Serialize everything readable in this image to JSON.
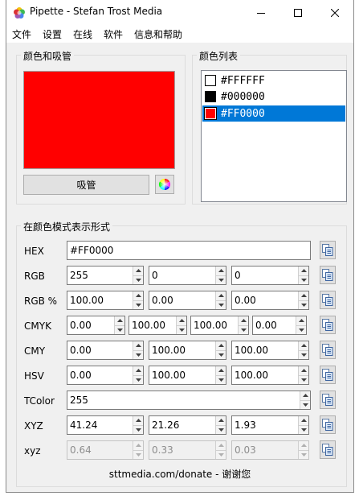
{
  "window": {
    "title": "Pipette - Stefan Trost Media"
  },
  "menu": [
    "文件",
    "设置",
    "在线",
    "软件",
    "信息和帮助"
  ],
  "color_group": {
    "title": "颜色和吸管",
    "pipette_button": "吸管",
    "preview_color": "#FF0000"
  },
  "list_group": {
    "title": "颜色列表",
    "items": [
      {
        "label": "#FFFFFF",
        "color": "#FFFFFF",
        "selected": false
      },
      {
        "label": "#000000",
        "color": "#000000",
        "selected": false
      },
      {
        "label": "#FF0000",
        "color": "#FF0000",
        "selected": true
      }
    ]
  },
  "modes_group": {
    "title": "在颜色模式表示形式",
    "rows": [
      {
        "label": "HEX",
        "fields": [
          "#FF0000"
        ]
      },
      {
        "label": "RGB",
        "fields": [
          "255",
          "0",
          "0"
        ]
      },
      {
        "label": "RGB %",
        "fields": [
          "100.00",
          "0.00",
          "0.00"
        ]
      },
      {
        "label": "CMYK",
        "fields": [
          "0.00",
          "100.00",
          "100.00",
          "0.00"
        ]
      },
      {
        "label": "CMY",
        "fields": [
          "0.00",
          "100.00",
          "100.00"
        ]
      },
      {
        "label": "HSV",
        "fields": [
          "0.00",
          "100.00",
          "100.00"
        ]
      },
      {
        "label": "TColor",
        "fields": [
          "255"
        ]
      },
      {
        "label": "XYZ",
        "fields": [
          "41.24",
          "21.26",
          "1.93"
        ]
      },
      {
        "label": "xyz",
        "fields": [
          "0.64",
          "0.33",
          "0.03"
        ]
      }
    ]
  },
  "footer": {
    "text": "sttmedia.com/donate - 谢谢您"
  }
}
